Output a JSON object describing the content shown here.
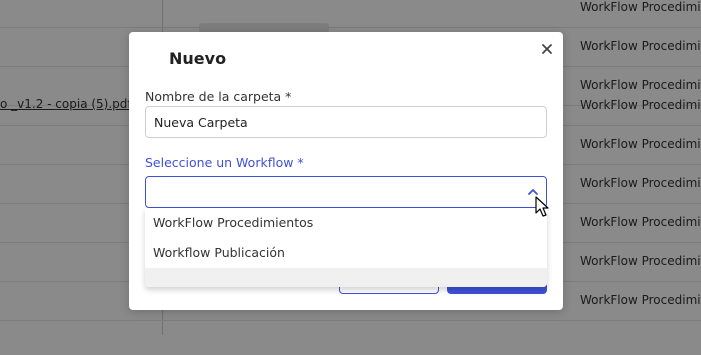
{
  "background": {
    "workflow_cell_text": "WorkFlow Procedimi",
    "file_link_text": "o _v1.2 - copia (5).pdf"
  },
  "modal": {
    "title": "Nuevo",
    "close_icon": "close-icon",
    "folder_name_label": "Nombre de la carpeta *",
    "folder_name_value": "Nueva Carpeta",
    "workflow_label": "Seleccione un Workflow *",
    "workflow_value": "",
    "accent_color": "#3f51d6"
  },
  "dropdown": {
    "options": [
      "WorkFlow Procedimientos",
      "Workflow Publicación"
    ]
  }
}
